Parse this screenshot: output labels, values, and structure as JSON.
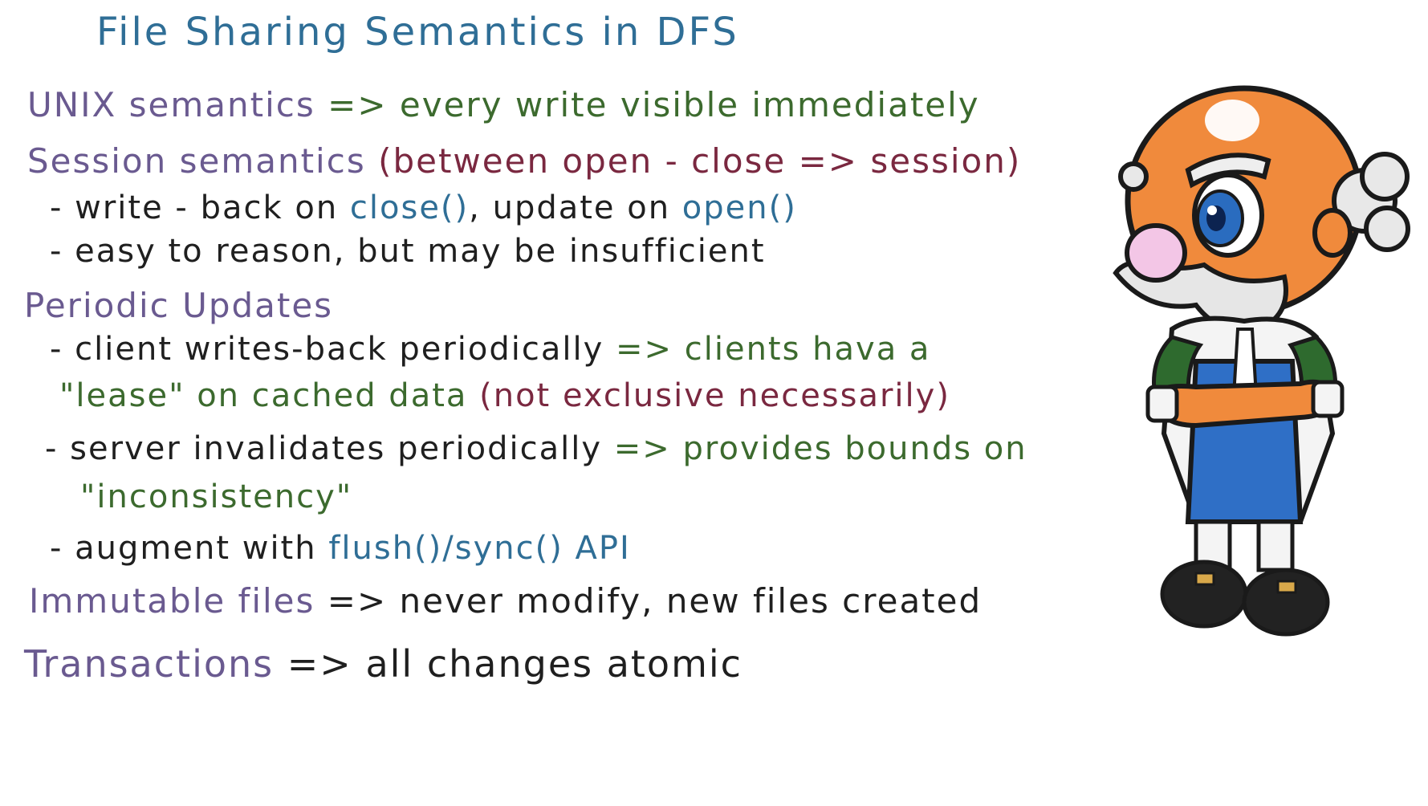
{
  "title": "File Sharing Semantics in DFS",
  "lines": {
    "unix": {
      "label": "UNIX semantics",
      "text": "=> every write visible immediately"
    },
    "session": {
      "label": "Session semantics",
      "text": "(between open - close => session)"
    },
    "session_b1": {
      "a": "- write - back on",
      "b": "close()",
      "c": ", update on",
      "d": "open()"
    },
    "session_b2": {
      "a": "- easy to reason, but may be insufficient"
    },
    "periodic": {
      "label": "Periodic Updates"
    },
    "periodic_b1": {
      "a": "- client writes-back periodically",
      "b": "=> clients hava a"
    },
    "periodic_b1_cont": {
      "a": "\"lease\" on cached data",
      "b": "(not exclusive necessarily)"
    },
    "periodic_b2": {
      "a": "- server invalidates periodically",
      "b": "=> provides bounds on"
    },
    "periodic_b2_cont": {
      "a": "\"inconsistency\""
    },
    "periodic_b3": {
      "a": "- augment with",
      "b": "flush()/sync() API"
    },
    "immutable": {
      "label": "Immutable files",
      "text": "=> never modify, new files created"
    },
    "transactions": {
      "label": "Transactions",
      "text": "=> all changes atomic"
    }
  },
  "colors": {
    "title": "#2f6e96",
    "heading": "#6a5a90",
    "note_green": "#3c6a2e",
    "note_maroon": "#7a2840",
    "code_blue": "#2f6e96",
    "ink": "#1f1f1f"
  },
  "mascot": {
    "icon": "professor-mascot-icon"
  }
}
